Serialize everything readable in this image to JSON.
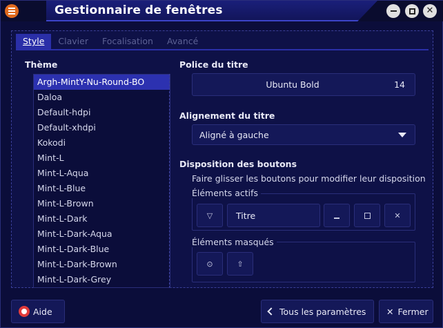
{
  "window": {
    "title": "Gestionnaire de fenêtres"
  },
  "tabs": [
    {
      "label": "Style"
    },
    {
      "label": "Clavier"
    },
    {
      "label": "Focalisation"
    },
    {
      "label": "Avancé"
    }
  ],
  "theme": {
    "label": "Thème",
    "items": [
      "Argh-MintY-Nu-Round-BO",
      "Daloa",
      "Default-hdpi",
      "Default-xhdpi",
      "Kokodi",
      "Mint-L",
      "Mint-L-Aqua",
      "Mint-L-Blue",
      "Mint-L-Brown",
      "Mint-L-Dark",
      "Mint-L-Dark-Aqua",
      "Mint-L-Dark-Blue",
      "Mint-L-Dark-Brown",
      "Mint-L-Dark-Grey"
    ],
    "selected_index": 0
  },
  "title_font": {
    "label": "Police du titre",
    "name": "Ubuntu Bold",
    "size": "14"
  },
  "title_alignment": {
    "label": "Alignement du titre",
    "value": "Aligné à gauche"
  },
  "button_layout": {
    "label": "Disposition des boutons",
    "hint": "Faire glisser les boutons pour modifier leur disposition",
    "active_label": "Éléments actifs",
    "hidden_label": "Éléments masqués",
    "title_item": "Titre"
  },
  "footer": {
    "help": "Aide",
    "all_settings": "Tous les paramètres",
    "close": "Fermer"
  },
  "colors": {
    "accent": "#2c31b0",
    "background": "#0b0d3a",
    "danger": "#e23b3b"
  }
}
